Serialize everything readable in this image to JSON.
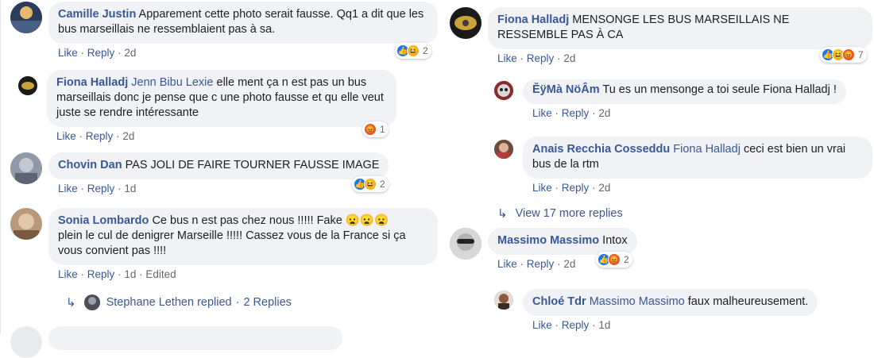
{
  "left": {
    "c1": {
      "author": "Camille Justin",
      "text": "Apparement cette photo serait fausse. Qq1 a dit que les bus marseillais ne ressemblaient pas à sa.",
      "like": "Like",
      "reply": "Reply",
      "time": "2d",
      "react_count": "2",
      "reacts": [
        "like-icon",
        "haha-icon"
      ]
    },
    "c1r1": {
      "author": "Fiona Halladj",
      "tag": "Jenn Bibu Lexie",
      "text": "elle ment ça n est pas un bus marseillais donc je pense que c une photo fausse et qu elle veut juste se rendre intéressante",
      "like": "Like",
      "reply": "Reply",
      "time": "2d",
      "react_count": "1",
      "reacts": [
        "angry-icon"
      ]
    },
    "c2": {
      "author": "Chovin Dan",
      "text": "PAS JOLI DE FAIRE TOURNER FAUSSE IMAGE",
      "like": "Like",
      "reply": "Reply",
      "time": "1d",
      "react_count": "2",
      "reacts": [
        "like-icon",
        "haha-icon"
      ]
    },
    "c3": {
      "author": "Sonia Lombardo",
      "text_line1": "Ce bus n est pas chez nous !!!!! Fake 😦😦😦",
      "text_line2": "plein le cul de denigrer Marseille !!!!! Cassez vous de la France si ça",
      "text_line3": "vous convient pas !!!!",
      "like": "Like",
      "reply": "Reply",
      "time": "1d",
      "edited": "Edited"
    },
    "c3_replies": {
      "name": "Stephane Lethen replied",
      "sep": "·",
      "count": "2 Replies"
    }
  },
  "right": {
    "c1": {
      "author": "Fiona Halladj",
      "text": "MENSONGE LES BUS MARSEILLAIS NE RESSEMBLE PAS À CA",
      "like": "Like",
      "reply": "Reply",
      "time": "2d",
      "react_count": "7",
      "reacts": [
        "like-icon",
        "haha-icon",
        "angry-icon"
      ]
    },
    "c1r1": {
      "author": "ĔÿMà NöÂm",
      "text": "Tu es un mensonge a toi seule Fiona Halladj !",
      "like": "Like",
      "reply": "Reply",
      "time": "2d"
    },
    "c1r2": {
      "author": "Anais Recchia Cosseddu",
      "tag": "Fiona Halladj",
      "text": "ceci est bien un vrai bus de la rtm",
      "like": "Like",
      "reply": "Reply",
      "time": "2d"
    },
    "more": {
      "label": "View 17 more replies"
    },
    "c2": {
      "author": "Massimo Massimo",
      "text": "Intox",
      "like": "Like",
      "reply": "Reply",
      "time": "2d",
      "react_count": "2",
      "reacts": [
        "like-icon",
        "angry-icon"
      ]
    },
    "c2r1": {
      "author": "Chloé Tdr",
      "tag": "Massimo Massimo",
      "text": "faux malheureusement.",
      "like": "Like",
      "reply": "Reply",
      "time": "1d"
    }
  },
  "colors": {
    "link": "#385898",
    "bubble": "#f0f2f5",
    "muted": "#65676b",
    "like": "#1877f2",
    "haha": "#f7b125",
    "angry": "#e4582f"
  }
}
